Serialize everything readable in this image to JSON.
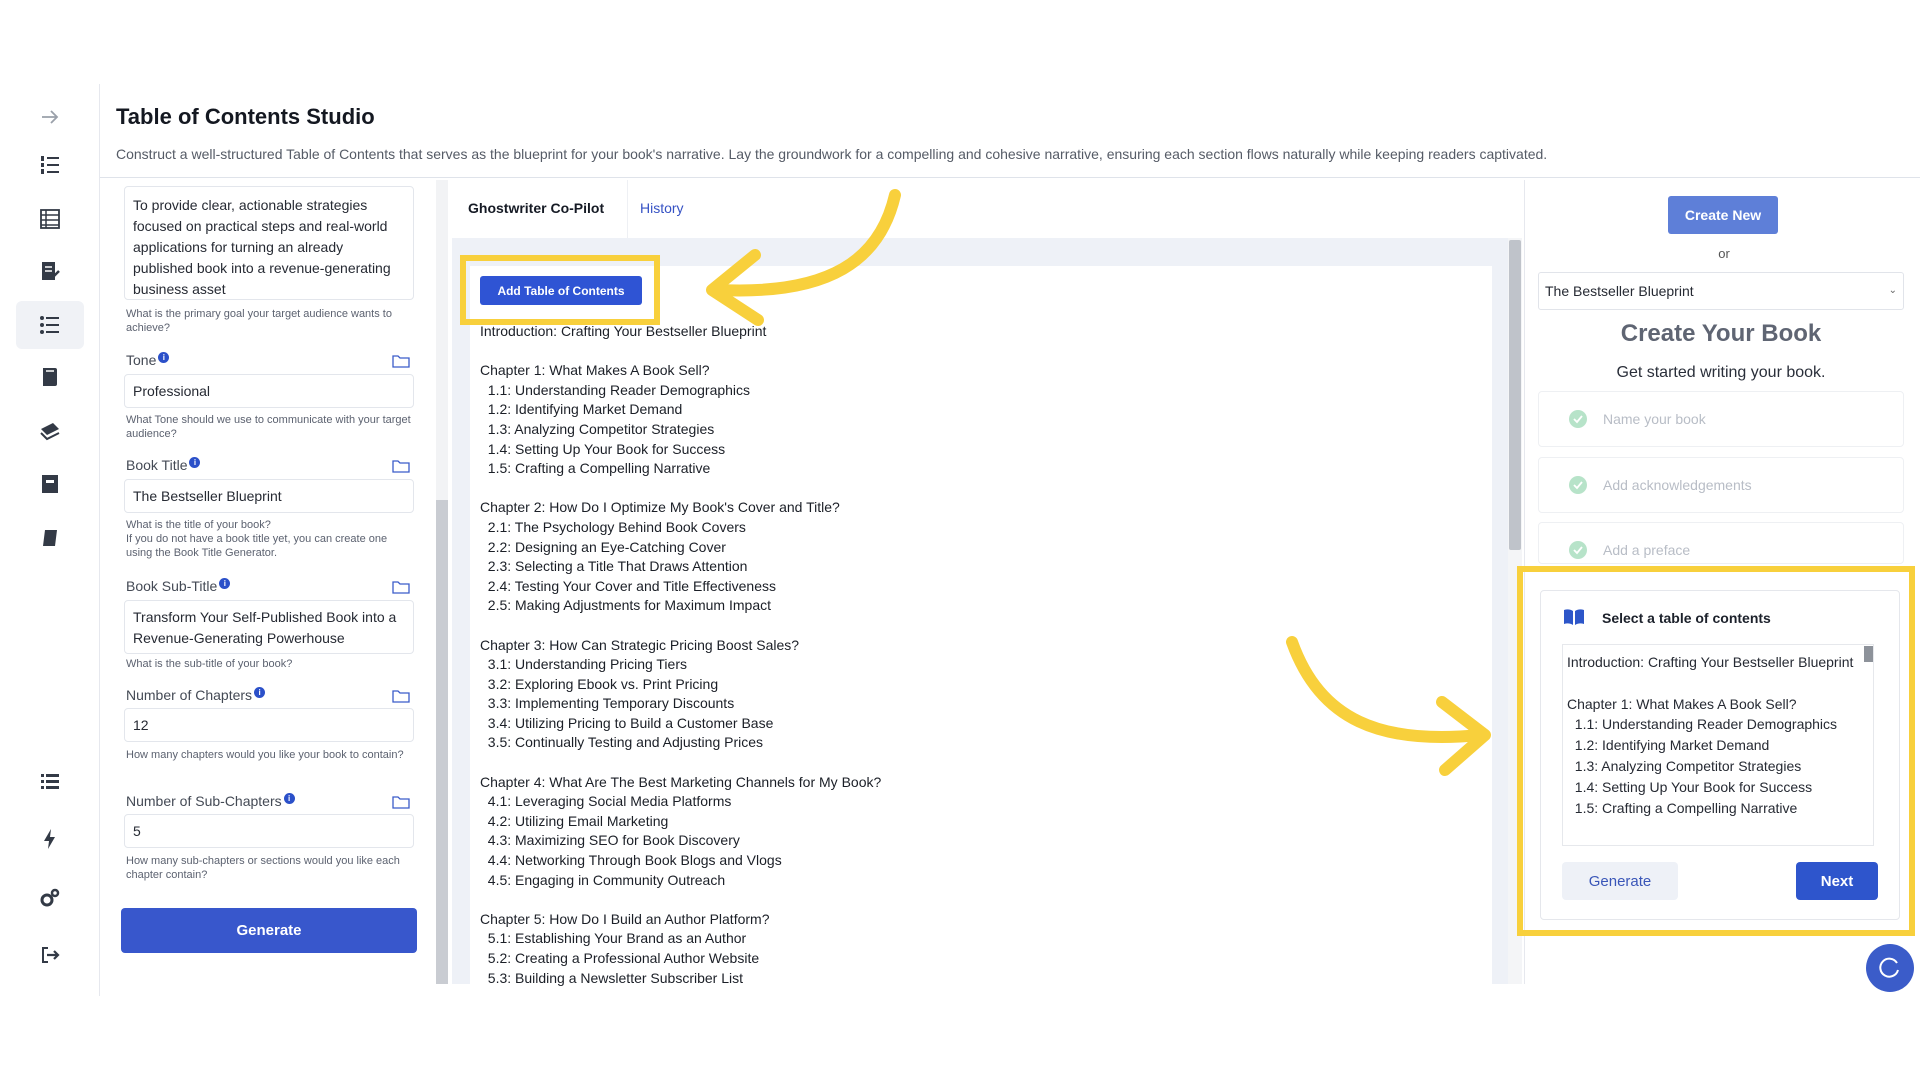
{
  "header": {
    "title": "Table of Contents Studio",
    "subtitle": "Construct a well-structured Table of Contents that serves as the blueprint for your book's narrative. Lay the groundwork for a compelling and cohesive narrative, ensuring each section flows naturally while keeping readers captivated."
  },
  "sidebar": {
    "icons": [
      "arrow-right-icon",
      "ordered-list-icon",
      "table-icon",
      "edit-document-icon",
      "toc-list-icon",
      "book-icon",
      "books-stack-icon",
      "archive-icon",
      "notebook-icon",
      "list-icon",
      "bolt-icon",
      "settings-icon",
      "logout-icon"
    ]
  },
  "form": {
    "goal_value": "To provide clear, actionable strategies focused on practical steps and real-world applications for turning an already published book into a revenue-generating business asset",
    "goal_help": "What is the primary goal your target audience wants to achieve?",
    "tone_label": "Tone",
    "tone_value": "Professional",
    "tone_help": "What Tone should we use to communicate with your target audience?",
    "title_label": "Book Title",
    "title_value": "The Bestseller Blueprint",
    "title_help": "What is the title of your book?\nIf you do not have a book title yet, you can create one using the Book Title Generator.",
    "subtitle_label": "Book Sub-Title",
    "subtitle_value": "Transform Your Self-Published Book into a Revenue-Generating Powerhouse",
    "subtitle_help": "What is the sub-title of your book?",
    "chapters_label": "Number of Chapters",
    "chapters_value": "12",
    "chapters_help": "How many chapters would you like your book to contain?",
    "subchapters_label": "Number of Sub-Chapters",
    "subchapters_value": "5",
    "subchapters_help": "How many sub-chapters or sections would you like each chapter contain?",
    "generate_label": "Generate"
  },
  "center": {
    "tabs": [
      {
        "label": "Ghostwriter Co-Pilot"
      },
      {
        "label": "History"
      }
    ],
    "add_toc_label": "Add Table of Contents",
    "toc_text": "Introduction: Crafting Your Bestseller Blueprint\n\nChapter 1: What Makes A Book Sell?\n  1.1: Understanding Reader Demographics\n  1.2: Identifying Market Demand\n  1.3: Analyzing Competitor Strategies\n  1.4: Setting Up Your Book for Success\n  1.5: Crafting a Compelling Narrative\n\nChapter 2: How Do I Optimize My Book's Cover and Title?\n  2.1: The Psychology Behind Book Covers\n  2.2: Designing an Eye-Catching Cover\n  2.3: Selecting a Title That Draws Attention\n  2.4: Testing Your Cover and Title Effectiveness\n  2.5: Making Adjustments for Maximum Impact\n\nChapter 3: How Can Strategic Pricing Boost Sales?\n  3.1: Understanding Pricing Tiers\n  3.2: Exploring Ebook vs. Print Pricing\n  3.3: Implementing Temporary Discounts\n  3.4: Utilizing Pricing to Build a Customer Base\n  3.5: Continually Testing and Adjusting Prices\n\nChapter 4: What Are The Best Marketing Channels for My Book?\n  4.1: Leveraging Social Media Platforms\n  4.2: Utilizing Email Marketing\n  4.3: Maximizing SEO for Book Discovery\n  4.4: Networking Through Book Blogs and Vlogs\n  4.5: Engaging in Community Outreach\n\nChapter 5: How Do I Build an Author Platform?\n  5.1: Establishing Your Brand as an Author\n  5.2: Creating a Professional Author Website\n  5.3: Building a Newsletter Subscriber List"
  },
  "right": {
    "create_new_label": "Create New",
    "or_label": "or",
    "selected_book": "The Bestseller Blueprint",
    "create_title": "Create Your Book",
    "create_subtitle": "Get started writing your book.",
    "steps": [
      {
        "label": "Name your book"
      },
      {
        "label": "Add acknowledgements"
      },
      {
        "label": "Add a preface"
      }
    ],
    "select_toc_label": "Select a table of contents",
    "toc_preview": "Introduction: Crafting Your Bestseller Blueprint\n\nChapter 1: What Makes A Book Sell?\n  1.1: Understanding Reader Demographics\n  1.2: Identifying Market Demand\n  1.3: Analyzing Competitor Strategies\n  1.4: Setting Up Your Book for Success\n  1.5: Crafting a Compelling Narrative",
    "generate_label": "Generate",
    "next_label": "Next"
  },
  "colors": {
    "primary": "#3857cc",
    "highlight": "#f8d03c",
    "check": "#b7e3c9"
  }
}
